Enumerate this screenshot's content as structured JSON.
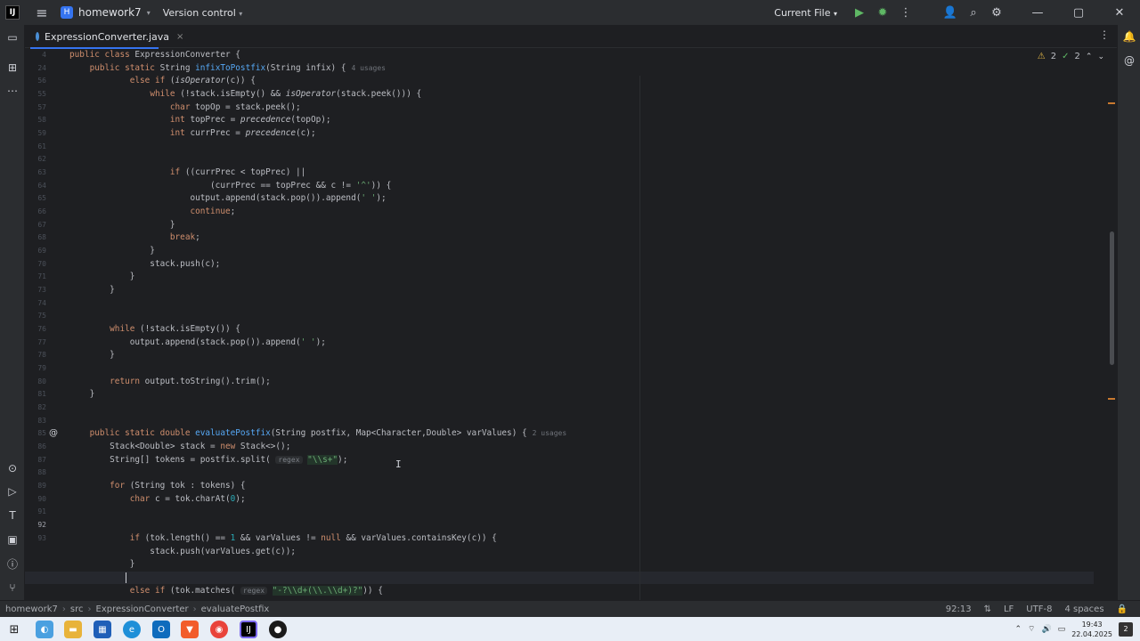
{
  "titlebar": {
    "project_badge": "H",
    "project_name": "homework7",
    "version_control": "Version control",
    "run_config": "Current File"
  },
  "tab": {
    "filename": "ExpressionConverter.java",
    "close": "×"
  },
  "inspections": {
    "warnings": "2",
    "ok": "2"
  },
  "gutter_lines": [
    "4",
    "24",
    "56",
    "55",
    "57",
    "58",
    "59",
    "61",
    "62",
    "63",
    "64",
    "65",
    "66",
    "67",
    "68",
    "69",
    "70",
    "71",
    "73",
    "74",
    "75",
    "76",
    "77",
    "78",
    "79",
    "80",
    "81",
    "82",
    "83",
    "85",
    "86",
    "87",
    "88",
    "89",
    "90",
    "91",
    "92",
    "93"
  ],
  "code": {
    "l0": [
      "public class ExpressionConverter {"
    ],
    "l1_hint": "4 usages",
    "l23_hint": "2 usages",
    "regex_label": "regex",
    "regex1": "\"\\\\s+\"",
    "regex2": "\"-?\\\\d+(\\\\.\\\\d+)?\""
  },
  "statusbar": {
    "crumbs": [
      "homework7",
      "src",
      "ExpressionConverter",
      "evaluatePostfix"
    ],
    "position": "92:13",
    "line_ending": "LF",
    "encoding": "UTF-8",
    "indent": "4 spaces"
  },
  "taskbar": {
    "time": "19:43",
    "date": "22.04.2025",
    "notifications": "2"
  }
}
